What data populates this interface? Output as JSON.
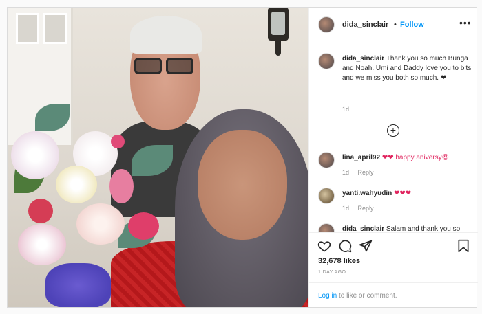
{
  "post": {
    "username": "dida_sinclair",
    "follow_label": "Follow",
    "more_label": "•••",
    "caption": "Thank you so much Bunga and Noah. Umi and Daddy love you to bits and we miss you both so much. ❤",
    "caption_time": "1d"
  },
  "comments": [
    {
      "username": "lina_april92",
      "text": "❤❤ happy aniversy😍",
      "time": "1d",
      "reply": "Reply"
    },
    {
      "username": "yanti.wahyudin",
      "text": "❤❤❤",
      "time": "1d",
      "reply": "Reply"
    },
    {
      "username": "dida_sinclair",
      "text": "Salam and thank you so much everyone for your warm"
    }
  ],
  "stats": {
    "likes": "32,678 likes",
    "posted": "1 DAY AGO"
  },
  "footer": {
    "login_link": "Log in",
    "login_suffix": " to like or comment."
  },
  "icons": [
    "heart-icon",
    "comment-icon",
    "share-icon",
    "bookmark-icon",
    "load-more-icon",
    "more-options-icon"
  ],
  "colors": {
    "follow_blue": "#0095f6",
    "heart_red": "#e0245e",
    "muted": "#8e8e8e"
  }
}
